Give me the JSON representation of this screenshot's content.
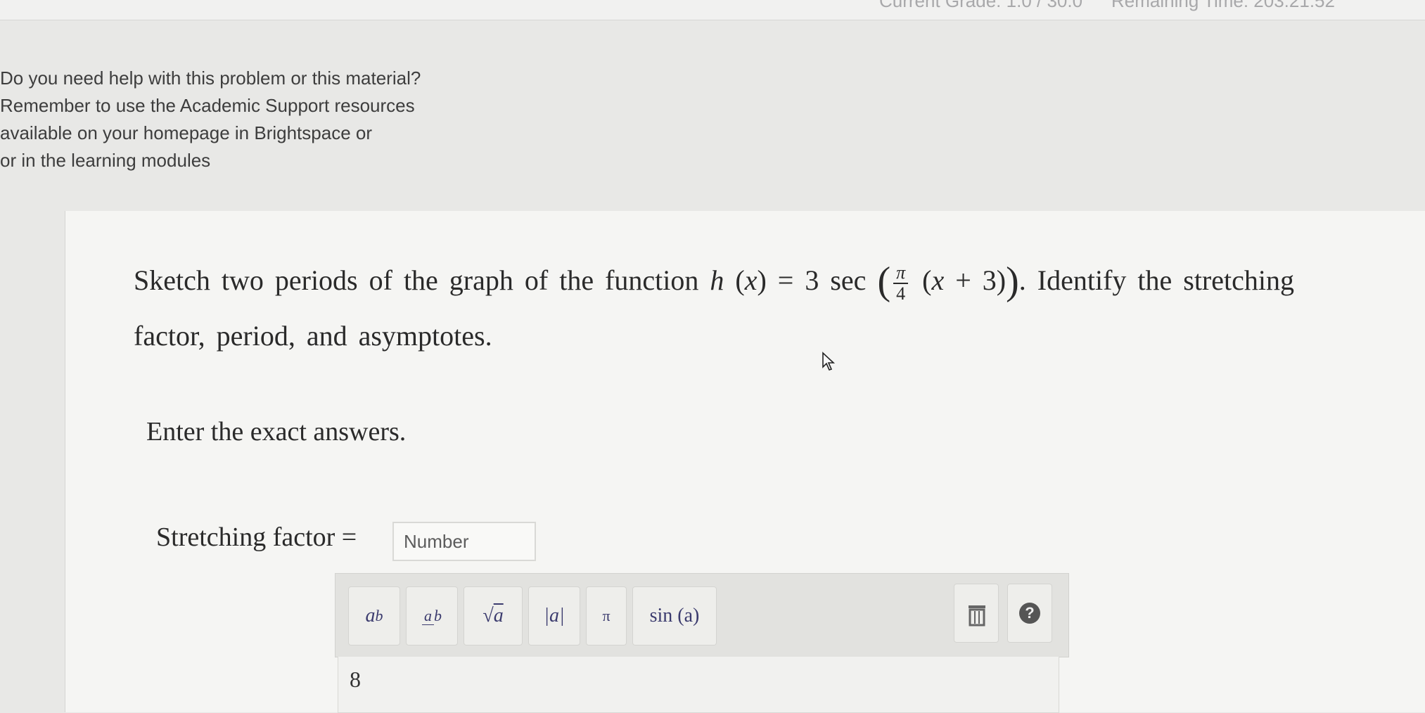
{
  "header": {
    "grade_text": "Current Grade: 1.0 / 30.0",
    "time_text": "Remaining Time: 203:21:52"
  },
  "help_text": {
    "lines": [
      "Do you need help with this problem or this material?",
      "Remember to use the Academic Support resources",
      "available on your homepage in Brightspace or",
      "or in the learning modules"
    ]
  },
  "question": {
    "prefix": "Sketch two periods of the graph of the function",
    "function_name": "h",
    "variable": "x",
    "equals_coeff": "3 sec",
    "frac_num": "π",
    "frac_den": "4",
    "shift": "+ 3",
    "suffix_1": ". Identify the stretching",
    "suffix_2": "factor, period, and asymptotes."
  },
  "instruction": "Enter the exact answers.",
  "stretching_factor": {
    "label": "Stretching factor =",
    "placeholder": "Number"
  },
  "toolbar": {
    "power_base": "a",
    "power_exp": "b",
    "frac_num": "a",
    "frac_den": "b",
    "sqrt_label": "a",
    "abs_label": "|a|",
    "pi_label": "π",
    "sin_label": "sin (a)",
    "help_label": "?"
  },
  "answer_area": {
    "value": "8"
  }
}
